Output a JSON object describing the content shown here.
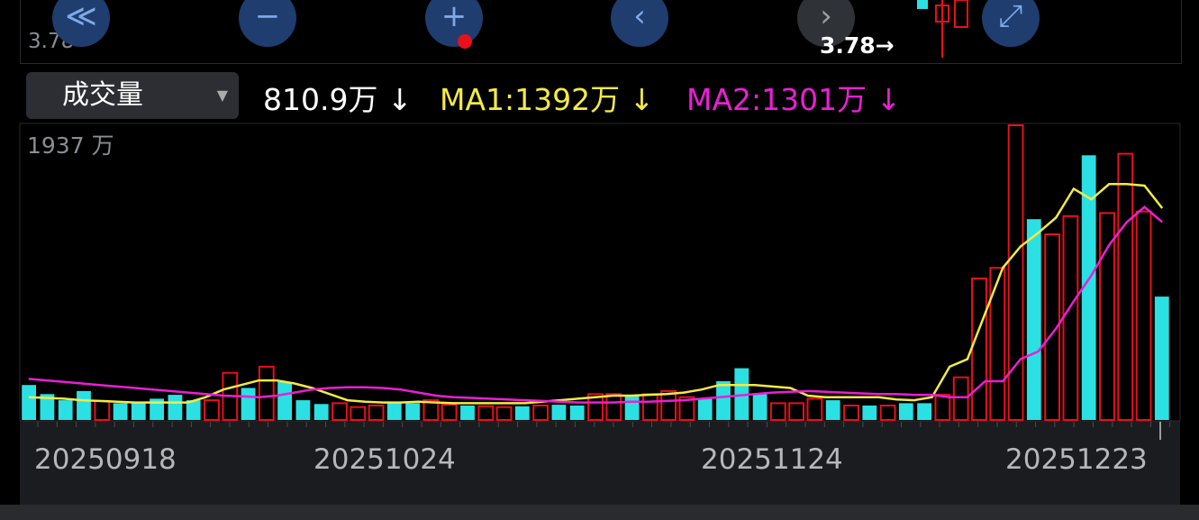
{
  "top_panel": {
    "price_label": "3.78",
    "price_arrow_label": "3.78→",
    "buttons": {
      "rewind_icon": "≪",
      "zoom_out_icon": "−",
      "zoom_in_icon": "+",
      "prev_icon": "‹",
      "next_icon": "›",
      "fullscreen_icon": "⤢"
    }
  },
  "header": {
    "selector_label": "成交量",
    "selector_caret": "▼",
    "current_volume": "810.9万 ↓",
    "ma1": "MA1:1392万 ↓",
    "ma2": "MA2:1301万 ↓"
  },
  "colors": {
    "up": "#e8101a",
    "down": "#2be0e3",
    "ma1": "#f3ea46",
    "ma2": "#ec1ed5"
  },
  "chart_data": {
    "type": "bar",
    "title": "成交量",
    "y_max_label": "1937 万",
    "ylim": [
      0,
      1937
    ],
    "x_tick_labels": [
      "20250918",
      "20251024",
      "20251124",
      "20251223"
    ],
    "bars": [
      {
        "v": 230,
        "dir": "down"
      },
      {
        "v": 170,
        "dir": "down"
      },
      {
        "v": 130,
        "dir": "down"
      },
      {
        "v": 190,
        "dir": "down"
      },
      {
        "v": 125,
        "dir": "up"
      },
      {
        "v": 110,
        "dir": "down"
      },
      {
        "v": 110,
        "dir": "down"
      },
      {
        "v": 140,
        "dir": "down"
      },
      {
        "v": 165,
        "dir": "down"
      },
      {
        "v": 130,
        "dir": "down"
      },
      {
        "v": 130,
        "dir": "up"
      },
      {
        "v": 310,
        "dir": "up"
      },
      {
        "v": 210,
        "dir": "down"
      },
      {
        "v": 350,
        "dir": "up"
      },
      {
        "v": 250,
        "dir": "down"
      },
      {
        "v": 130,
        "dir": "down"
      },
      {
        "v": 105,
        "dir": "down"
      },
      {
        "v": 110,
        "dir": "up"
      },
      {
        "v": 85,
        "dir": "up"
      },
      {
        "v": 95,
        "dir": "up"
      },
      {
        "v": 110,
        "dir": "down"
      },
      {
        "v": 110,
        "dir": "down"
      },
      {
        "v": 130,
        "dir": "up"
      },
      {
        "v": 100,
        "dir": "up"
      },
      {
        "v": 95,
        "dir": "down"
      },
      {
        "v": 90,
        "dir": "up"
      },
      {
        "v": 85,
        "dir": "up"
      },
      {
        "v": 90,
        "dir": "down"
      },
      {
        "v": 95,
        "dir": "up"
      },
      {
        "v": 100,
        "dir": "down"
      },
      {
        "v": 95,
        "dir": "down"
      },
      {
        "v": 170,
        "dir": "up"
      },
      {
        "v": 170,
        "dir": "up"
      },
      {
        "v": 165,
        "dir": "down"
      },
      {
        "v": 170,
        "dir": "up"
      },
      {
        "v": 190,
        "dir": "up"
      },
      {
        "v": 150,
        "dir": "up"
      },
      {
        "v": 140,
        "dir": "down"
      },
      {
        "v": 255,
        "dir": "down"
      },
      {
        "v": 340,
        "dir": "down"
      },
      {
        "v": 170,
        "dir": "down"
      },
      {
        "v": 110,
        "dir": "up"
      },
      {
        "v": 110,
        "dir": "up"
      },
      {
        "v": 140,
        "dir": "up"
      },
      {
        "v": 130,
        "dir": "down"
      },
      {
        "v": 95,
        "dir": "up"
      },
      {
        "v": 95,
        "dir": "down"
      },
      {
        "v": 95,
        "dir": "up"
      },
      {
        "v": 110,
        "dir": "down"
      },
      {
        "v": 110,
        "dir": "down"
      },
      {
        "v": 165,
        "dir": "up"
      },
      {
        "v": 280,
        "dir": "up"
      },
      {
        "v": 930,
        "dir": "up"
      },
      {
        "v": 1000,
        "dir": "up"
      },
      {
        "v": 1937,
        "dir": "up"
      },
      {
        "v": 1320,
        "dir": "down"
      },
      {
        "v": 1220,
        "dir": "up"
      },
      {
        "v": 1340,
        "dir": "up"
      },
      {
        "v": 1740,
        "dir": "down"
      },
      {
        "v": 1360,
        "dir": "up"
      },
      {
        "v": 1750,
        "dir": "up"
      },
      {
        "v": 1370,
        "dir": "up"
      },
      {
        "v": 810.9,
        "dir": "down"
      }
    ],
    "ma1": [
      150,
      145,
      140,
      130,
      125,
      120,
      115,
      115,
      115,
      115,
      150,
      200,
      230,
      260,
      260,
      240,
      210,
      170,
      130,
      120,
      115,
      115,
      120,
      115,
      110,
      110,
      110,
      110,
      110,
      120,
      130,
      140,
      150,
      160,
      160,
      165,
      170,
      180,
      200,
      230,
      230,
      230,
      220,
      210,
      160,
      150,
      150,
      150,
      150,
      135,
      130,
      150,
      350,
      400,
      700,
      1000,
      1140,
      1230,
      1330,
      1520,
      1450,
      1550,
      1550,
      1540,
      1392
    ],
    "ma2": [
      270,
      260,
      250,
      240,
      230,
      220,
      210,
      200,
      190,
      180,
      170,
      160,
      155,
      150,
      160,
      180,
      200,
      210,
      215,
      215,
      210,
      200,
      180,
      160,
      150,
      145,
      140,
      135,
      130,
      125,
      120,
      115,
      115,
      115,
      120,
      120,
      125,
      130,
      140,
      150,
      160,
      170,
      180,
      185,
      190,
      185,
      180,
      175,
      170,
      170,
      165,
      165,
      150,
      150,
      255,
      255,
      400,
      450,
      600,
      780,
      950,
      1150,
      1300,
      1400,
      1301
    ]
  }
}
